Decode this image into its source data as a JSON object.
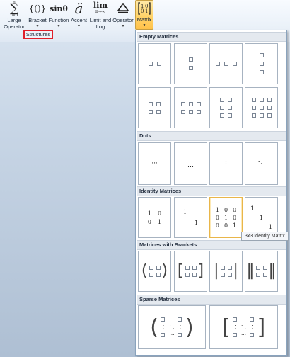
{
  "ribbon": {
    "buttons": [
      {
        "icon": "∑",
        "label1": "Large",
        "label2": "Operator"
      },
      {
        "icon": "{()}",
        "label1": "Bracket",
        "label2": ""
      },
      {
        "icon": "sinθ",
        "label1": "Function",
        "label2": ""
      },
      {
        "icon": "ä",
        "label1": "Accent",
        "label2": ""
      },
      {
        "icon": "lim",
        "label1": "Limit and",
        "label2": "Log"
      },
      {
        "icon": "Δ̲",
        "label1": "Operator",
        "label2": ""
      },
      {
        "icon": "[10 01]",
        "label1": "Matrix",
        "label2": ""
      }
    ],
    "group_label": "Structures"
  },
  "panel": {
    "sections": {
      "empty": "Empty Matrices",
      "dots": "Dots",
      "identity": "Identity Matrices",
      "brackets": "Matrices with Brackets",
      "sparse": "Sparse Matrices"
    },
    "dots_glyphs": [
      "···",
      "…",
      "⋮",
      "⋱"
    ],
    "identity": {
      "m2": [
        "1",
        "0",
        "0",
        "1"
      ],
      "m2s": [
        "1",
        "1"
      ],
      "m3": [
        "1",
        "0",
        "0",
        "0",
        "1",
        "0",
        "0",
        "0",
        "1"
      ],
      "m3s": [
        "1",
        "1",
        "1"
      ]
    },
    "sparse_glyphs": [
      "⋯",
      "⋮",
      "⋱"
    ],
    "tooltip": "3x3 Identity Matrix"
  },
  "colors": {
    "highlight": "#ffd46a",
    "group_outline": "#e0202a"
  }
}
